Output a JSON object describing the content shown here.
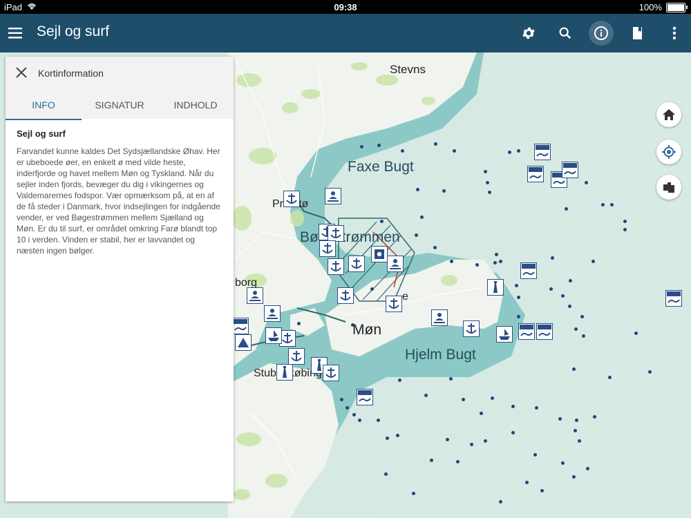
{
  "status_bar": {
    "device": "iPad",
    "time": "09:38",
    "battery": "100%"
  },
  "app_bar": {
    "title": "Sejl og surf",
    "icons": [
      "menu-icon",
      "gear-icon",
      "search-icon",
      "info-icon",
      "book-icon",
      "more-vert-icon"
    ]
  },
  "panel": {
    "title": "Kortinformation",
    "tabs": [
      {
        "label": "INFO",
        "active": true
      },
      {
        "label": "SIGNATUR",
        "active": false
      },
      {
        "label": "INDHOLD",
        "active": false
      }
    ],
    "heading": "Sejl og surf",
    "body": "Farvandet kunne kaldes Det Sydsjællandske Øhav. Her er ubeboede øer, en enkelt ø med vilde heste, inderfjorde og havet mellem Møn og Tyskland. Når du sejler inden fjords, bevæger du dig i vikingernes og Valdemarernes fodspor. Vær opmærksom på, at en af de få steder i Danmark, hvor indsejlingen for indgående vender, er ved Bøgestrømmen mellem Sjælland og Møn. Er du til surf, er området omkring Farø blandt top 10 i verden. Vinden er stabil, her er lavvandet og næsten ingen bølger."
  },
  "map": {
    "places": {
      "stevns": "Stevns",
      "faxe_bugt": "Faxe Bugt",
      "praesto": "Præstø",
      "bogestrommen": "Bøgestrømmen",
      "vordingborg": "borg",
      "mon": "Møn",
      "hjelm_bugt": "Hjelm Bugt",
      "stubbekobing": "Stubbekøbing",
      "stege": "e"
    },
    "colors": {
      "land": "#f1f3ee",
      "sea": "#d6e9e3",
      "shallow": "#8cc9c6",
      "marker_blue": "#2a4d86"
    }
  },
  "map_controls": [
    "home-icon",
    "my-location-icon",
    "layers-icon"
  ]
}
